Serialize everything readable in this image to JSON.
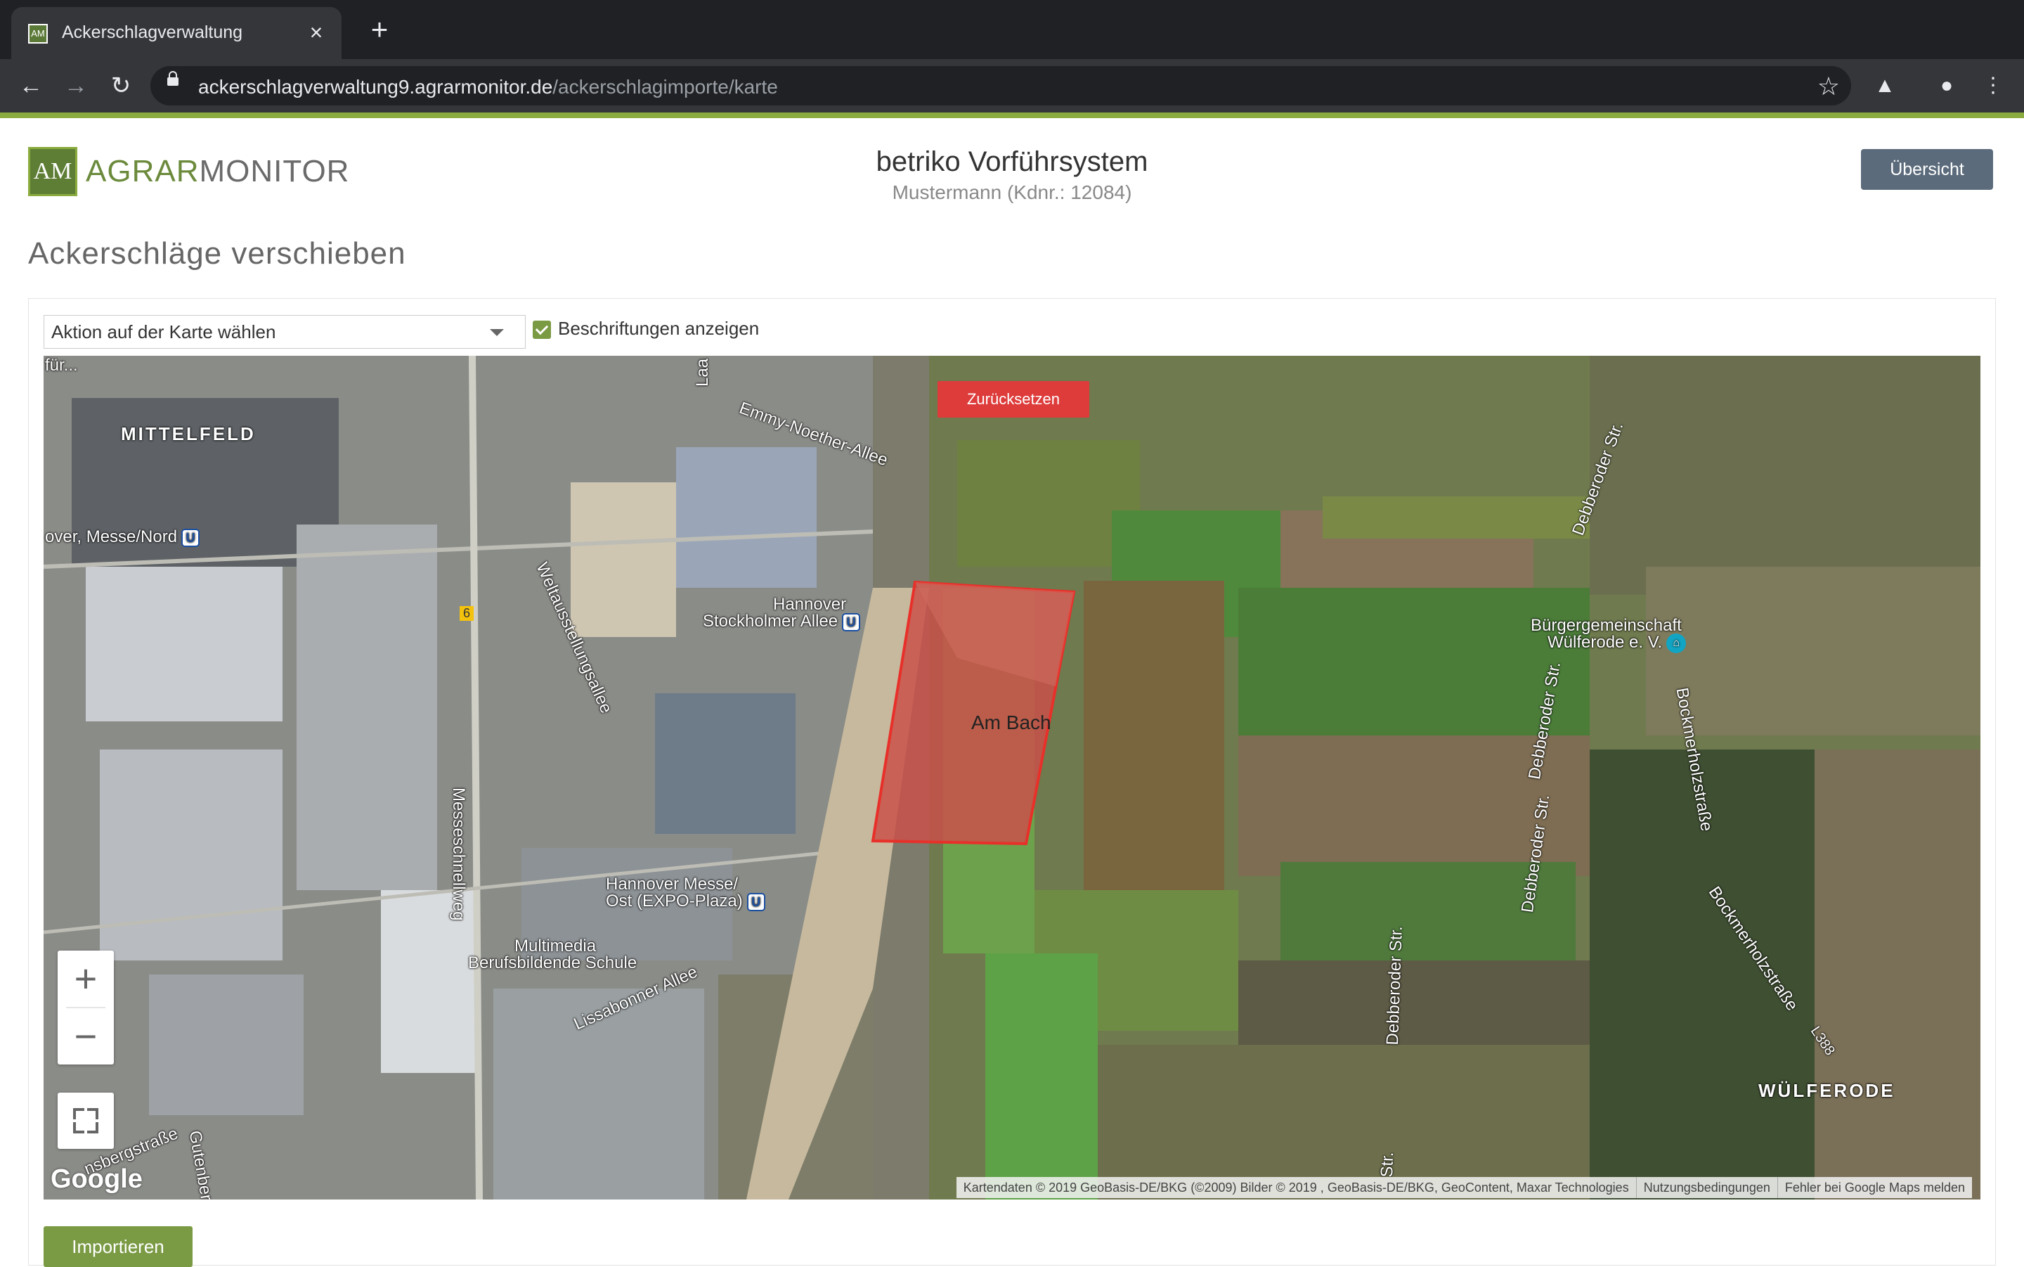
{
  "browser": {
    "tab_title": "Ackerschlagverwaltung",
    "tab_favicon": "AM",
    "url_domain": "ackerschlagverwaltung9.agrarmonitor.de",
    "url_path": "/ackerschlagimporte/karte"
  },
  "header": {
    "logo_mark": "AM",
    "logo_text_a": "AGRAR",
    "logo_text_b": "MONITOR",
    "system_title": "betriko Vorführsystem",
    "system_subtitle": "Mustermann (Kdnr.: 12084)",
    "overview_button": "Übersicht"
  },
  "page": {
    "heading": "Ackerschläge verschieben"
  },
  "controls": {
    "action_select_value": "Aktion auf der Karte wählen",
    "show_labels_checked": true,
    "show_labels_label": "Beschriftungen anzeigen"
  },
  "map": {
    "reset_button": "Zurücksetzen",
    "field_label": "Am Bach",
    "zoom_in": "+",
    "zoom_out": "−",
    "google_logo": "Google",
    "attribution": "Kartendaten © 2019 GeoBasis-DE/BKG (©2009) Bilder © 2019 , GeoBasis-DE/BKG, GeoContent, Maxar Technologies",
    "terms": "Nutzungsbedingungen",
    "report_error": "Fehler bei Google Maps melden",
    "labels": {
      "top_left": "für...",
      "mittelfeld": "MITTELFELD",
      "messe_nord": "over, Messe/Nord",
      "emmy": "Emmy-Noether-Allee",
      "lau": "Laa",
      "weltausstellungsallee": "Weltausstellungsallee",
      "stockholmer_1": "Hannover",
      "stockholmer_2": "Stockholmer Allee",
      "route_6": "6",
      "messeschnellweg": "Messeschnellweg",
      "expo_1": "Hannover Messe/",
      "expo_2": "Ost (EXPO-Plaza)",
      "multimedia_1": "Multimedia",
      "multimedia_2": "Berufsbildende Schule",
      "lissabonner": "Lissabonner Allee",
      "hansbergstr": "nsbergstraße",
      "gutenberg": "Gutenberg",
      "debberoder1": "Debberoder Str.",
      "debberoder2": "Debberoder Str.",
      "debberoder3": "Debberoder Str.",
      "debberoder4": "Debberoder Str.",
      "debberoder5": "Str.",
      "buerger_1": "Bürgergemeinschaft",
      "buerger_2": "Wülferode e. V.",
      "bockmerholz1": "Bockmerholzstraße",
      "bockmerholz2": "Bockmerholzstraße",
      "l388": "L388",
      "wuelferode": "WÜLFERODE",
      "u": "U"
    }
  },
  "footer": {
    "import_button": "Importieren"
  }
}
